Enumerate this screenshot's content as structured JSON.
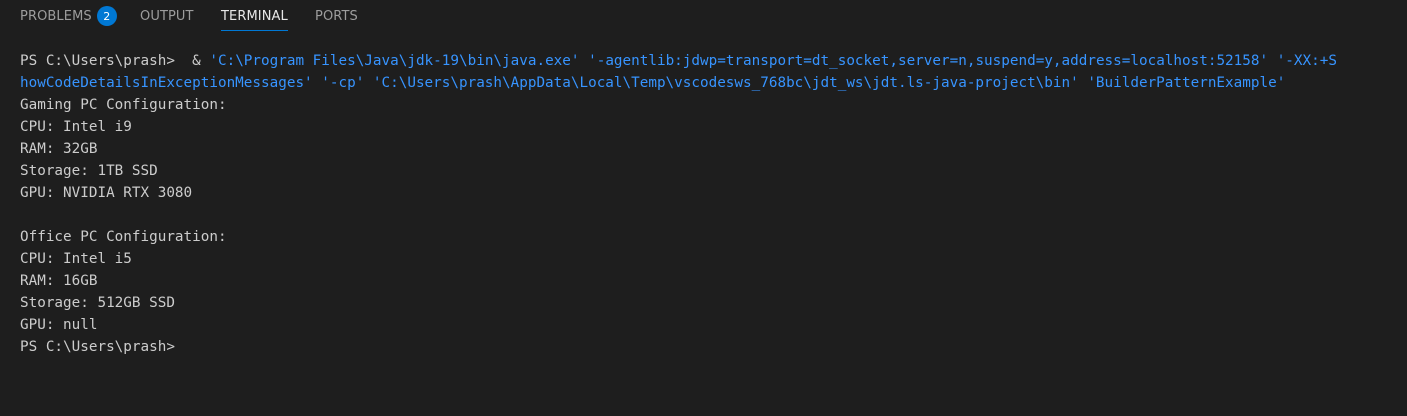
{
  "tabs": [
    {
      "label": "PROBLEMS",
      "badge": "2"
    },
    {
      "label": "OUTPUT"
    },
    {
      "label": "TERMINAL"
    },
    {
      "label": "PORTS"
    }
  ],
  "terminal": {
    "prompt": "PS C:\\Users\\prash>",
    "amp": "  & ",
    "cmd_line1": "'C:\\Program Files\\Java\\jdk-19\\bin\\java.exe' '-agentlib:jdwp=transport=dt_socket,server=n,suspend=y,address=localhost:52158' '-XX:+S",
    "cmd_line2": "howCodeDetailsInExceptionMessages' '-cp' 'C:\\Users\\prash\\AppData\\Local\\Temp\\vscodesws_768bc\\jdt_ws\\jdt.ls-java-project\\bin' 'BuilderPatternExample'",
    "output": [
      "Gaming PC Configuration:",
      "CPU: Intel i9",
      "RAM: 32GB",
      "Storage: 1TB SSD",
      "GPU: NVIDIA RTX 3080",
      "",
      "Office PC Configuration:",
      "CPU: Intel i5",
      "RAM: 16GB",
      "Storage: 512GB SSD",
      "GPU: null"
    ],
    "final_prompt": "PS C:\\Users\\prash>"
  },
  "colors": {
    "background": "#1e1e1e",
    "accent": "#0078d4",
    "command": "#3794ff",
    "text": "#cccccc"
  }
}
